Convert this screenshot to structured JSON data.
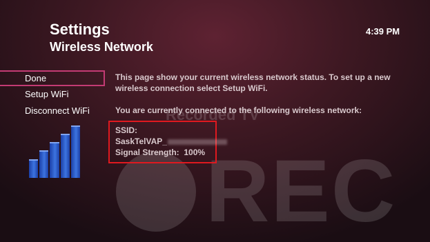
{
  "header": {
    "title": "Settings",
    "subtitle": "Wireless Network",
    "time": "4:39 PM"
  },
  "menu": {
    "items": [
      {
        "label": "Done",
        "selected": true
      },
      {
        "label": "Setup WiFi",
        "selected": false
      },
      {
        "label": "Disconnect WiFi",
        "selected": false
      }
    ]
  },
  "signal_icon": {
    "icon": "wifi-signal-bars-icon",
    "level": 1.0,
    "bars": 5
  },
  "content": {
    "status_text": "This page show your current wireless network status. To set up a new wireless connection select Setup WiFi.",
    "connected_text": "You are currently connected to the following wireless network:",
    "ssid_label": "SSID:",
    "ssid_value": "SaskTelVAP_",
    "signal_strength_label": "Signal Strength:",
    "signal_strength_value": "100%"
  },
  "watermark": {
    "recorded_text": "Recorded TV",
    "rec_text": "REC"
  },
  "colors": {
    "highlight_border": "#c43b74",
    "annotation_box": "#e0191f",
    "signal_bar": "#3d74e0"
  }
}
